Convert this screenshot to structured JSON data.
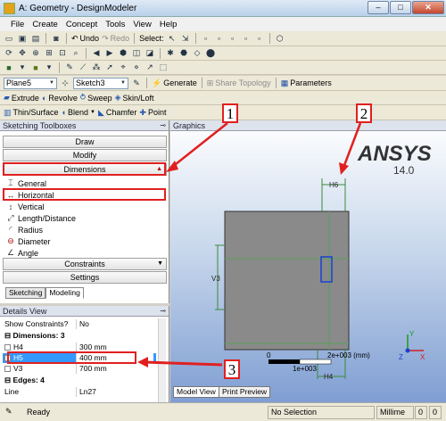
{
  "window": {
    "title": "A: Geometry - DesignModeler"
  },
  "menu": [
    "File",
    "Create",
    "Concept",
    "Tools",
    "View",
    "Help"
  ],
  "toolbar1": {
    "undo": "Undo",
    "redo": "Redo",
    "select_label": "Select:"
  },
  "toolbar4": {
    "plane": "Plane5",
    "sketch": "Sketch3",
    "generate": "Generate",
    "share_topology": "Share Topology",
    "parameters": "Parameters"
  },
  "toolbar5": {
    "extrude": "Extrude",
    "revolve": "Revolve",
    "sweep": "Sweep",
    "skin_loft": "Skin/Loft"
  },
  "toolbar6": {
    "thin_surface": "Thin/Surface",
    "blend": "Blend",
    "chamfer": "Chamfer",
    "point": "Point"
  },
  "sketching": {
    "header": "Sketching Toolboxes",
    "draw": "Draw",
    "modify": "Modify",
    "dimensions": "Dimensions",
    "tools": [
      "General",
      "Horizontal",
      "Vertical",
      "Length/Distance",
      "Radius",
      "Diameter",
      "Angle"
    ],
    "constraints": "Constraints",
    "settings": "Settings",
    "tab_sketching": "Sketching",
    "tab_modeling": "Modeling"
  },
  "details": {
    "header": "Details View",
    "show_constraints_label": "Show Constraints?",
    "show_constraints_value": "No",
    "dimensions_group": "Dimensions: 3",
    "rows": [
      {
        "name": "H4",
        "value": "300 mm"
      },
      {
        "name": "H5",
        "value": "400 mm"
      },
      {
        "name": "V3",
        "value": "700 mm"
      }
    ],
    "edges_group": "Edges: 4",
    "line_label": "Line",
    "line_value": "Ln27"
  },
  "graphics": {
    "header": "Graphics",
    "logo_text": "ANSYS",
    "version": "14.0",
    "dim_h6": "H6",
    "dim_v3": "V3",
    "dim_h4": "H4",
    "scale_zero": "0",
    "scale_max": "2e+003 (mm)",
    "scale_mid": "1e+003",
    "axis_x": "X",
    "axis_y": "Y",
    "axis_z": "Z",
    "tab_model_view": "Model View",
    "tab_print_preview": "Print Preview"
  },
  "status": {
    "ready": "Ready",
    "selection": "No Selection",
    "unit": "Millime",
    "v1": "0",
    "v2": "0"
  },
  "annotations": {
    "c1": "1",
    "c2": "2",
    "c3": "3"
  },
  "colors": {
    "highlight": "#e02020",
    "selection": "#3399ff"
  }
}
